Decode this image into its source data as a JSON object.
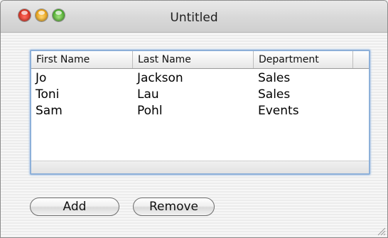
{
  "window": {
    "title": "Untitled"
  },
  "table": {
    "columns": [
      "First Name",
      "Last Name",
      "Department"
    ],
    "rows": [
      [
        "Jo",
        "Jackson",
        "Sales"
      ],
      [
        "Toni",
        "Lau",
        "Sales"
      ],
      [
        "Sam",
        "Pohl",
        "Events"
      ]
    ]
  },
  "buttons": {
    "add": "Add",
    "remove": "Remove"
  },
  "colors": {
    "focus_ring": "#8db0d9",
    "close": "#d32f1f",
    "minimize": "#e49d12",
    "zoom": "#4aa92c"
  }
}
